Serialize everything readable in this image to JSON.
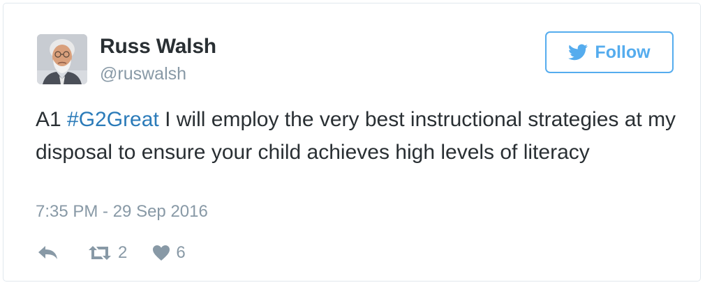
{
  "author": {
    "name": "Russ Walsh",
    "handle": "@ruswalsh"
  },
  "follow_button": {
    "label": "Follow",
    "icon": "twitter-bird-icon"
  },
  "tweet": {
    "prefix": "A1 ",
    "hashtag": "#G2Great",
    "body": " I will employ the very best instructional strategies at my disposal to ensure your child achieves high levels of literacy",
    "timestamp": "7:35 PM - 29 Sep 2016"
  },
  "actions": {
    "reply_icon": "reply-icon",
    "retweet_icon": "retweet-icon",
    "retweet_count": "2",
    "like_icon": "heart-icon",
    "like_count": "6"
  },
  "colors": {
    "accent": "#55acee",
    "hashtag": "#2b7bb9",
    "text": "#292f33",
    "muted": "#8899a6",
    "border": "#e1e8ed"
  }
}
